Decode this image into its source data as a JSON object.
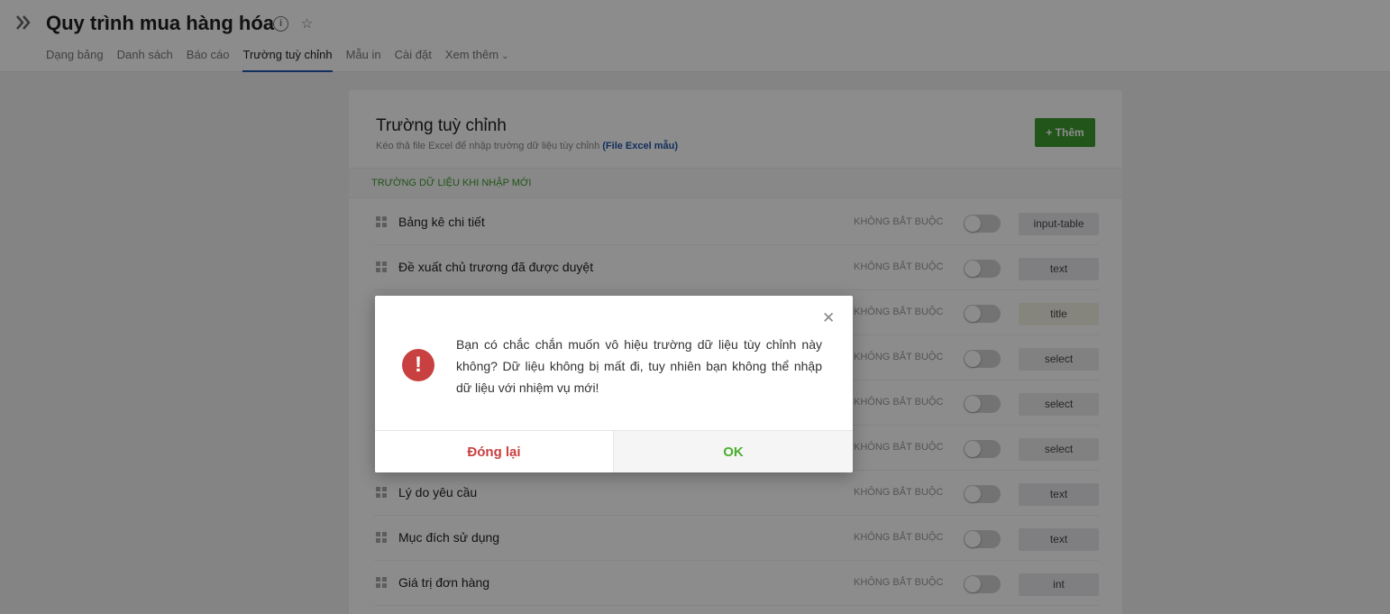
{
  "app": {
    "title": "Quy trình mua hàng hóa",
    "logo_icon": "x-logo-icon",
    "info_icon": "info-icon",
    "star_icon": "star-icon"
  },
  "tabs": [
    {
      "label": "Dạng bảng",
      "active": false
    },
    {
      "label": "Danh sách",
      "active": false
    },
    {
      "label": "Báo cáo",
      "active": false
    },
    {
      "label": "Trường tuỳ chỉnh",
      "active": true
    },
    {
      "label": "Mẫu in",
      "active": false
    },
    {
      "label": "Cài đặt",
      "active": false
    },
    {
      "label": "Xem thêm",
      "active": false
    }
  ],
  "panel": {
    "title": "Trường tuỳ chỉnh",
    "subtitle": "Kéo thả file Excel để nhập trường dữ liệu tùy chỉnh ",
    "subtitle_link": "(File Excel mẫu)",
    "add_button": "+ Thêm",
    "section_header": "TRƯỜNG DỮ LIỆU KHI NHẬP MỚI"
  },
  "fields": [
    {
      "label": "Bảng kê chi tiết",
      "required": "KHÔNG BẮT BUỘC",
      "enabled": false,
      "type": "input-table"
    },
    {
      "label": "Đề xuất chủ trương đã được duyệt",
      "required": "KHÔNG BẮT BUỘC",
      "enabled": false,
      "type": "text"
    },
    {
      "label": "",
      "required": "KHÔNG BẮT BUỘC",
      "enabled": false,
      "type": "title"
    },
    {
      "label": "",
      "required": "KHÔNG BẮT BUỘC",
      "enabled": false,
      "type": "select"
    },
    {
      "label": "",
      "required": "KHÔNG BẮT BUỘC",
      "enabled": false,
      "type": "select"
    },
    {
      "label": "",
      "required": "KHÔNG BẮT BUỘC",
      "enabled": false,
      "type": "select"
    },
    {
      "label": "Lý do yêu cầu",
      "required": "KHÔNG BẮT BUỘC",
      "enabled": false,
      "type": "text"
    },
    {
      "label": "Mục đích sử dụng",
      "required": "KHÔNG BẮT BUỘC",
      "enabled": false,
      "type": "text"
    },
    {
      "label": "Giá trị đơn hàng",
      "required": "KHÔNG BẮT BUỘC",
      "enabled": false,
      "type": "int"
    }
  ],
  "modal": {
    "message": "Bạn có chắc chắn muốn vô hiệu trường dữ liệu tùy chỉnh này không? Dữ liệu không bị mất đi, tuy nhiên bạn không thể nhập dữ liệu với nhiệm vụ mới!",
    "close_label": "Đóng lại",
    "ok_label": "OK",
    "icon": "alert-icon",
    "close_icon": "close-icon"
  },
  "colors": {
    "accent_green": "#3d9c2e",
    "alert_red": "#c94040",
    "ok_green": "#4caf2e",
    "tab_underline": "#1f55a8"
  }
}
